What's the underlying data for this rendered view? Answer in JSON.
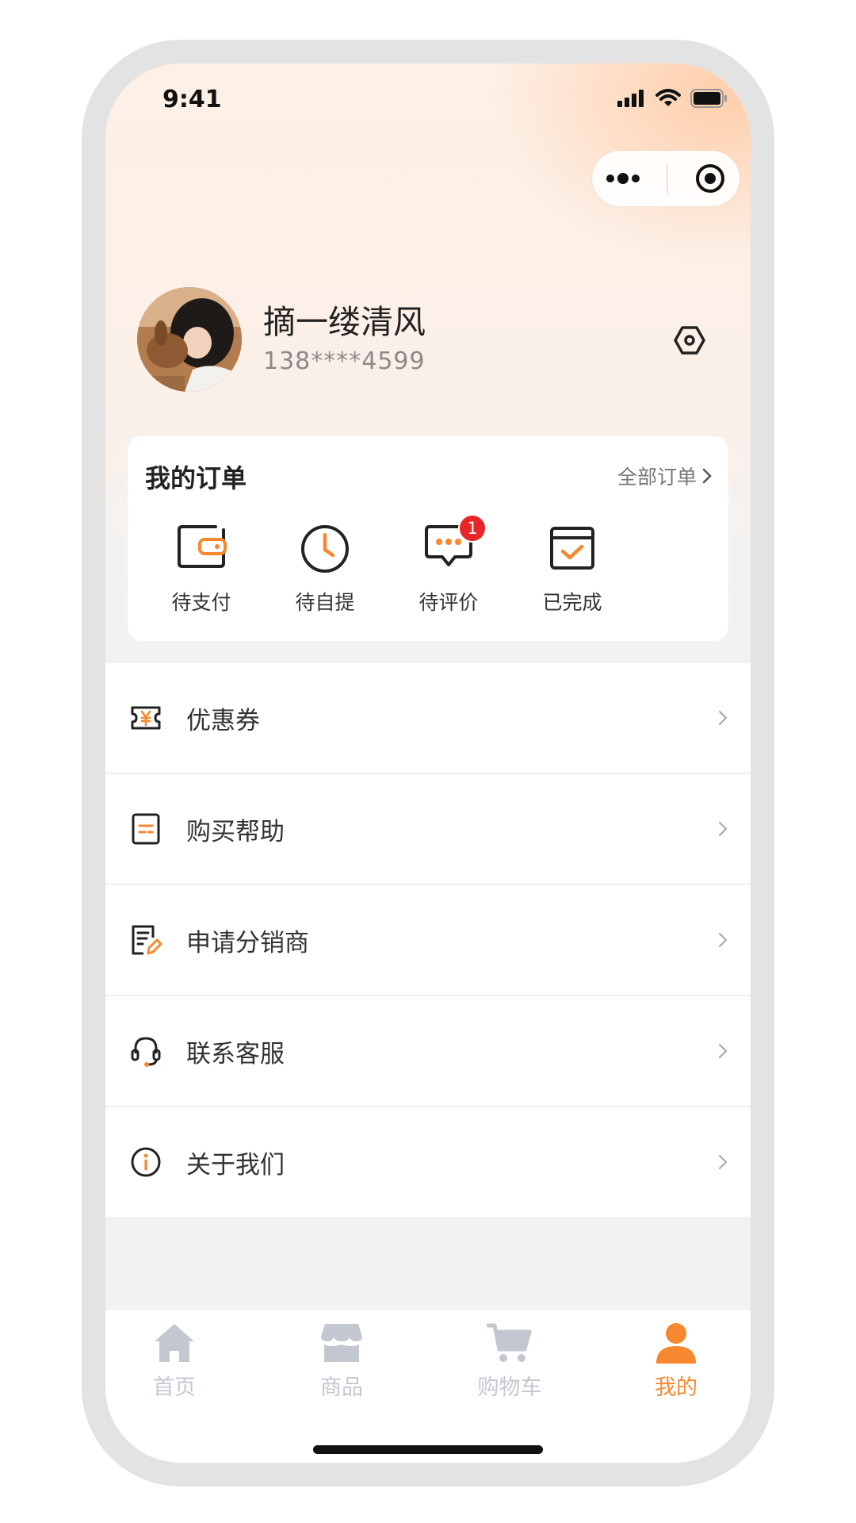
{
  "status_bar": {
    "time": "9:41"
  },
  "profile": {
    "name": "摘一缕清风",
    "phone": "138****4599"
  },
  "orders": {
    "title": "我的订单",
    "all_label": "全部订单",
    "items": [
      {
        "label": "待支付",
        "icon": "wallet-icon"
      },
      {
        "label": "待自提",
        "icon": "clock-icon"
      },
      {
        "label": "待评价",
        "icon": "comment-icon",
        "badge": "1"
      },
      {
        "label": "已完成",
        "icon": "calendar-check-icon"
      }
    ]
  },
  "menu": [
    {
      "label": "优惠券",
      "icon": "coupon-icon"
    },
    {
      "label": "购买帮助",
      "icon": "help-document-icon"
    },
    {
      "label": "申请分销商",
      "icon": "apply-edit-icon"
    },
    {
      "label": "联系客服",
      "icon": "headset-icon"
    },
    {
      "label": "关于我们",
      "icon": "info-icon"
    }
  ],
  "tabbar": [
    {
      "label": "首页",
      "icon": "home-icon",
      "active": false
    },
    {
      "label": "商品",
      "icon": "store-icon",
      "active": false
    },
    {
      "label": "购物车",
      "icon": "cart-icon",
      "active": false
    },
    {
      "label": "我的",
      "icon": "user-icon",
      "active": true
    }
  ],
  "colors": {
    "accent": "#f7882f",
    "badge": "#e8262a",
    "tab_inactive": "#c3c7cf"
  }
}
